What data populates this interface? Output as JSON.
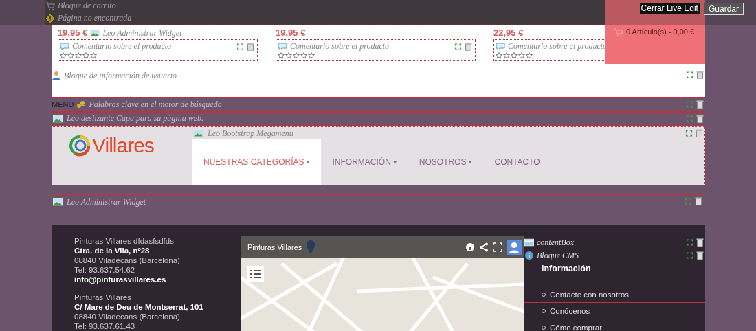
{
  "toolbar": {
    "buttons": [
      {
        "label": "Cerrar Live Edit",
        "kind": "plain"
      },
      {
        "label": "Guardar",
        "kind": "outlined"
      }
    ]
  },
  "cart": {
    "summary": "0 Artículo(s) - 0,00 €"
  },
  "top_modules": [
    {
      "label": "Bloque de carrito",
      "kind": "cart"
    },
    {
      "label": "Página no encontrada",
      "kind": "warning"
    }
  ],
  "product_widget_label": "Leo Administrar Widget",
  "products": [
    {
      "price": "19,95 €",
      "widget": "Comentario sobre el producto",
      "stars": 0
    },
    {
      "price": "19,95 €",
      "widget": "Comentario sobre el producto",
      "stars": 0
    },
    {
      "price": "22,95 €",
      "widget": "Comentario sobre el producto",
      "stars": 0
    }
  ],
  "user_block": {
    "label": "Bloque de información de usuario"
  },
  "menu_label": "MENU",
  "search_block": {
    "label": "Palabras clave en el motor de búsqueda"
  },
  "slider_block": {
    "label": "Leo deslizante Capa para su página web."
  },
  "header": {
    "logo": "Villares",
    "megamenu_label": "Leo Bootstrap Megamenu",
    "nav": [
      {
        "label": "NUESTRAS CATEGORÍAS",
        "selected": true,
        "dropdown": true
      },
      {
        "label": "INFORMACIÓN",
        "selected": false,
        "dropdown": true
      },
      {
        "label": "NOSOTROS",
        "selected": false,
        "dropdown": true
      },
      {
        "label": "CONTACTO",
        "selected": false,
        "dropdown": false
      }
    ]
  },
  "widget_block": {
    "label": "Leo Administrar Widget"
  },
  "footer": {
    "addresses": [
      {
        "lines": [
          {
            "text": "Pinturas Villares dfdasfsdfds",
            "bold": false
          },
          {
            "text": "Ctra. de la Vila, nº28",
            "bold": true
          },
          {
            "text": "08840 Viladecans (Barcelona)",
            "bold": false
          },
          {
            "text": "Tel: 93.637.54.62",
            "bold": false
          },
          {
            "text": "info@pinturasvillares.es",
            "bold": true
          }
        ]
      },
      {
        "lines": [
          {
            "text": "Pinturas Villares",
            "bold": false
          },
          {
            "text": "C/ Mare de Deu de Montserrat, 101",
            "bold": true
          },
          {
            "text": "08840 Viladecans (Barcelona)",
            "bold": false
          },
          {
            "text": "Tel: 93.637.61.43",
            "bold": false
          }
        ]
      }
    ],
    "map": {
      "title": "Pinturas Villares"
    },
    "content_box": "contentBox",
    "cms_block": "Bloque CMS",
    "heading": "Información",
    "links": [
      "Contacte con nosotros",
      "Conócenos",
      "Cómo comprar"
    ]
  }
}
